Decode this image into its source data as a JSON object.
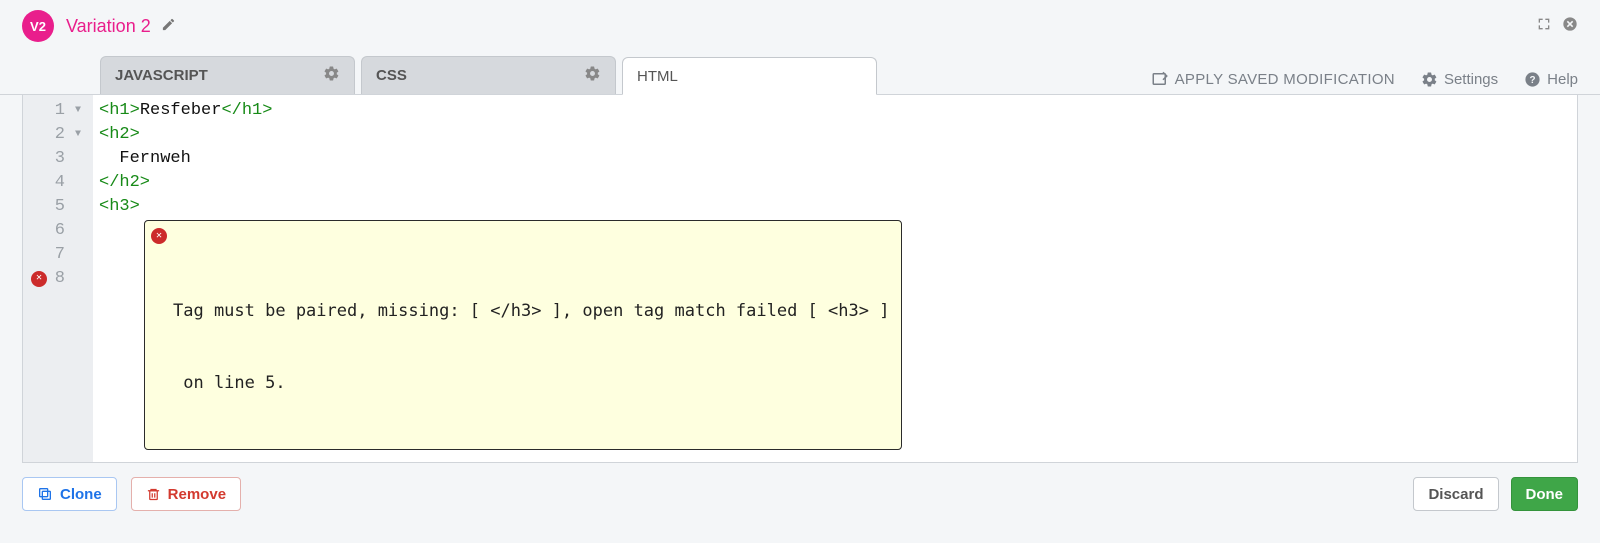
{
  "header": {
    "badge": "V2",
    "title": "Variation 2"
  },
  "tabs": {
    "js": "JAVASCRIPT",
    "css": "CSS",
    "html": "HTML"
  },
  "toolbar": {
    "apply": "APPLY SAVED MODIFICATION",
    "settings": "Settings",
    "help": "Help"
  },
  "code_lines": [
    {
      "n": "1",
      "fold": true,
      "segments": [
        {
          "t": "tag",
          "v": "<h1>"
        },
        {
          "t": "txt",
          "v": "Resfeber"
        },
        {
          "t": "tag",
          "v": "</h1>"
        }
      ]
    },
    {
      "n": "2",
      "fold": true,
      "segments": [
        {
          "t": "tag",
          "v": "<h2>"
        }
      ]
    },
    {
      "n": "3",
      "fold": false,
      "segments": [
        {
          "t": "txt",
          "v": "  Fernweh"
        }
      ]
    },
    {
      "n": "4",
      "fold": false,
      "segments": [
        {
          "t": "tag",
          "v": "</h2>"
        }
      ]
    },
    {
      "n": "5",
      "fold": false,
      "segments": [
        {
          "t": "tag",
          "v": "<h3>"
        }
      ]
    },
    {
      "n": "6",
      "fold": false,
      "segments": []
    },
    {
      "n": "7",
      "fold": false,
      "segments": []
    },
    {
      "n": "8",
      "fold": false,
      "segments": []
    }
  ],
  "error": {
    "gutter_line_index": 7,
    "line1": "Tag must be paired, missing: [ </h3> ], open tag match failed [ <h3> ]",
    "line2": " on line 5."
  },
  "footer": {
    "clone": "Clone",
    "remove": "Remove",
    "discard": "Discard",
    "done": "Done"
  }
}
